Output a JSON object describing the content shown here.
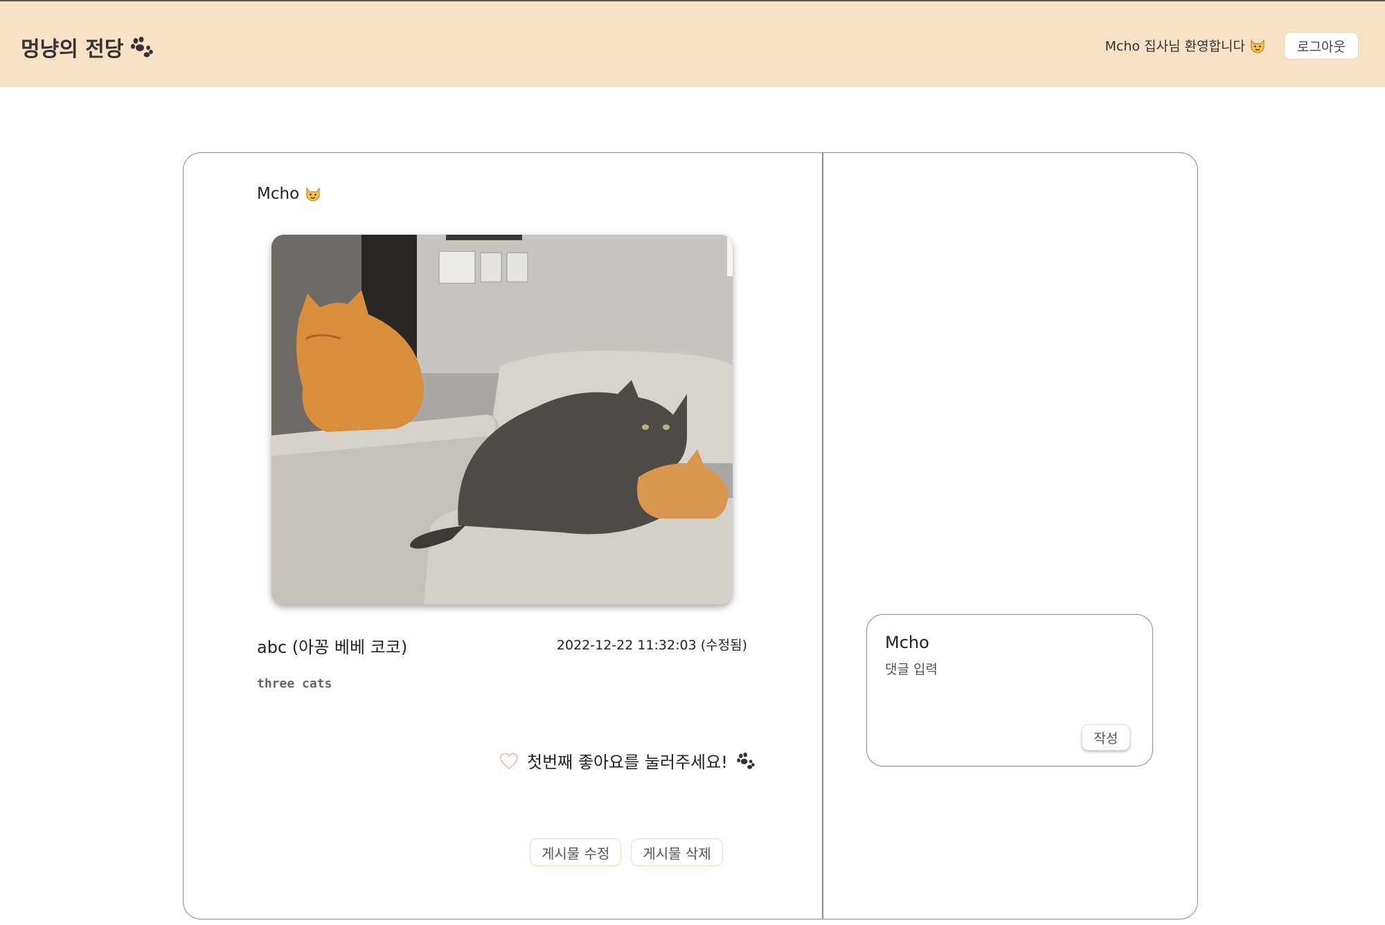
{
  "header": {
    "brand": "멍냥의 전당",
    "welcome": "Mcho 집사님 환영합니다",
    "logout_label": "로그아웃",
    "background_color": "#f7e2c6"
  },
  "post": {
    "author": "Mcho",
    "image_alt": "three cats",
    "title": "abc (아꽁 베베 코코)",
    "date": "2022-12-22 11:32:03 (수정됨)",
    "body": "three cats",
    "like_prompt": "첫번째 좋아요를 눌러주세요!",
    "edit_label": "게시물 수정",
    "delete_label": "게시물 삭제"
  },
  "comment": {
    "user": "Mcho",
    "placeholder": "댓글 입력",
    "submit_label": "작성"
  },
  "icons": {
    "brand": "paw-icon",
    "welcome": "cat-face-icon",
    "author": "cat-face-icon",
    "like": "heart-outline-icon",
    "like_suffix": "paw-icon"
  }
}
